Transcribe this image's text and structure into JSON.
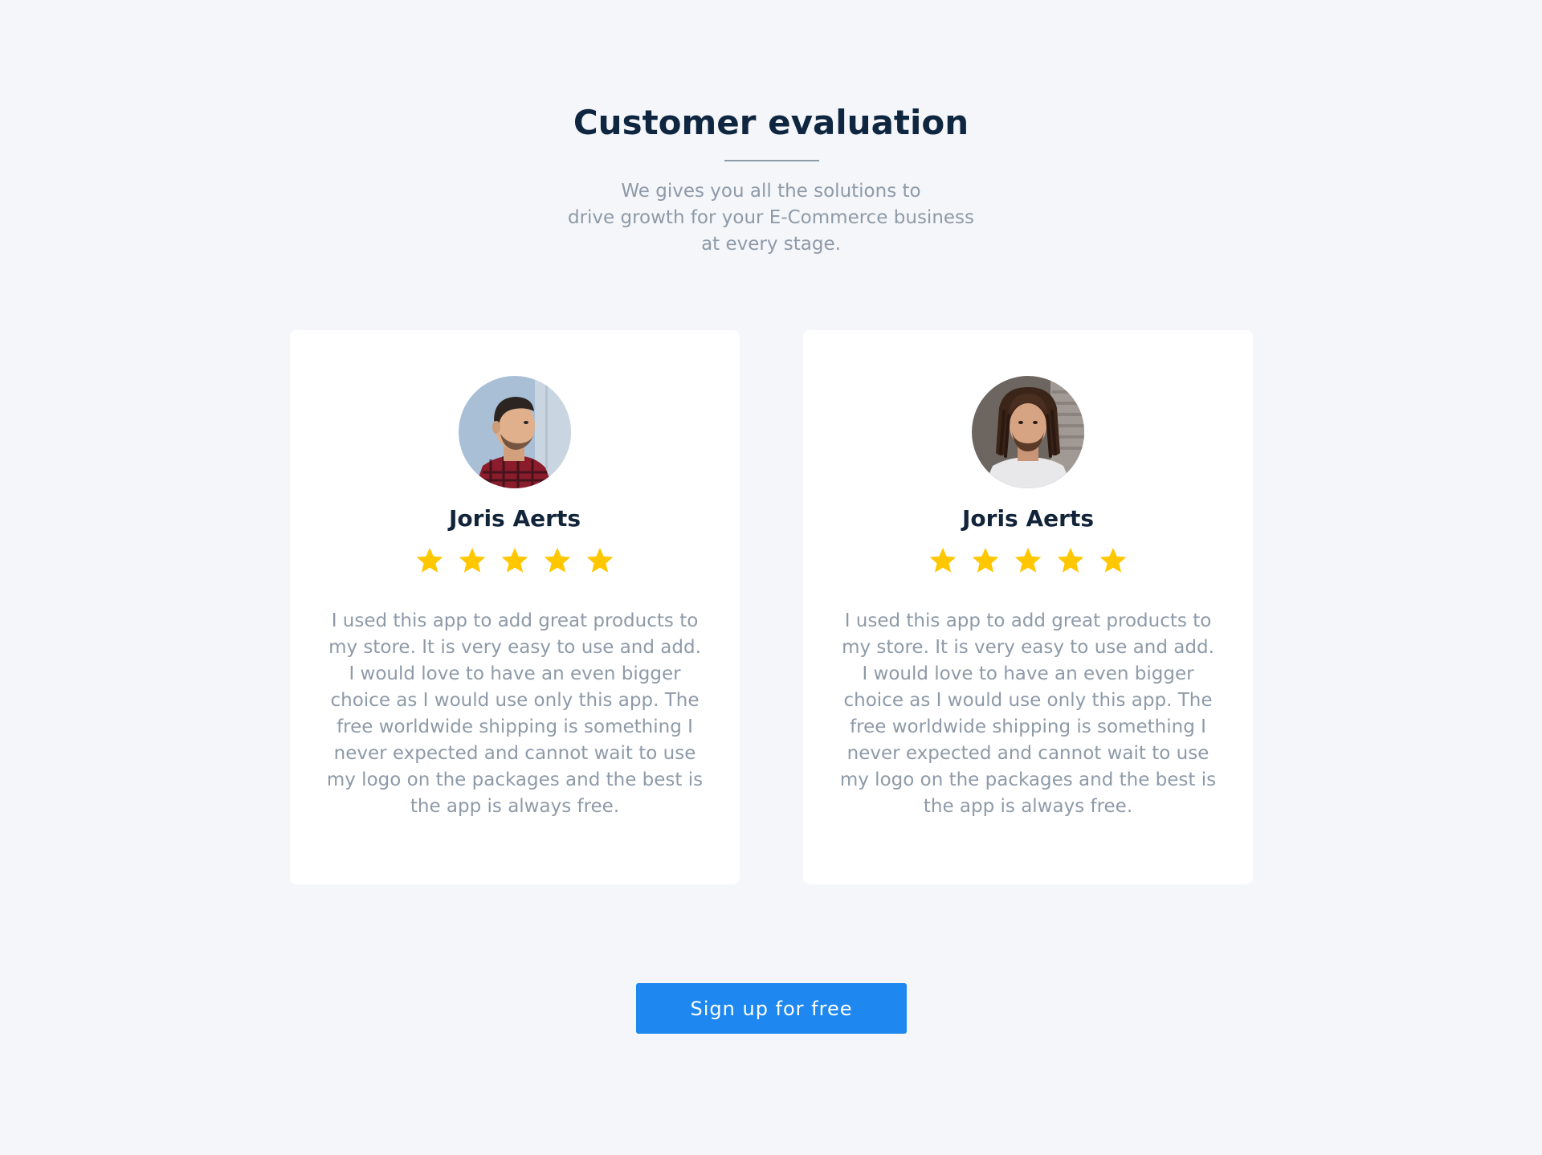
{
  "header": {
    "title": "Customer evaluation",
    "subtitle_lines": [
      "We gives you all the solutions to",
      "drive growth for your E-Commerce business",
      "at every stage."
    ]
  },
  "testimonials": [
    {
      "name": "Joris Aerts",
      "rating": 5,
      "rating_max": 5,
      "text": "I used this app to add great products to my store. It is very easy to use and add. I would love to have an even bigger choice as I would use only this app. The free worldwide shipping is something I never expected and cannot wait to use my logo on the packages and the best is the app is always free.",
      "avatar_icon": "person-photo-short-hair"
    },
    {
      "name": "Joris Aerts",
      "rating": 5,
      "rating_max": 5,
      "text": "I used this app to add great products to my store. It is very easy to use and add. I would love to have an even bigger choice as I would use only this app. The free worldwide shipping is something I never expected and cannot wait to use my logo on the packages and the best is the app is always free.",
      "avatar_icon": "person-photo-dreadlocks"
    }
  ],
  "cta": {
    "label": "Sign up for free"
  },
  "colors": {
    "background": "#f4f6f9",
    "title": "#0f2640",
    "muted_text": "#8e9aa8",
    "star": "#ffc700",
    "button": "#1e88f0"
  }
}
